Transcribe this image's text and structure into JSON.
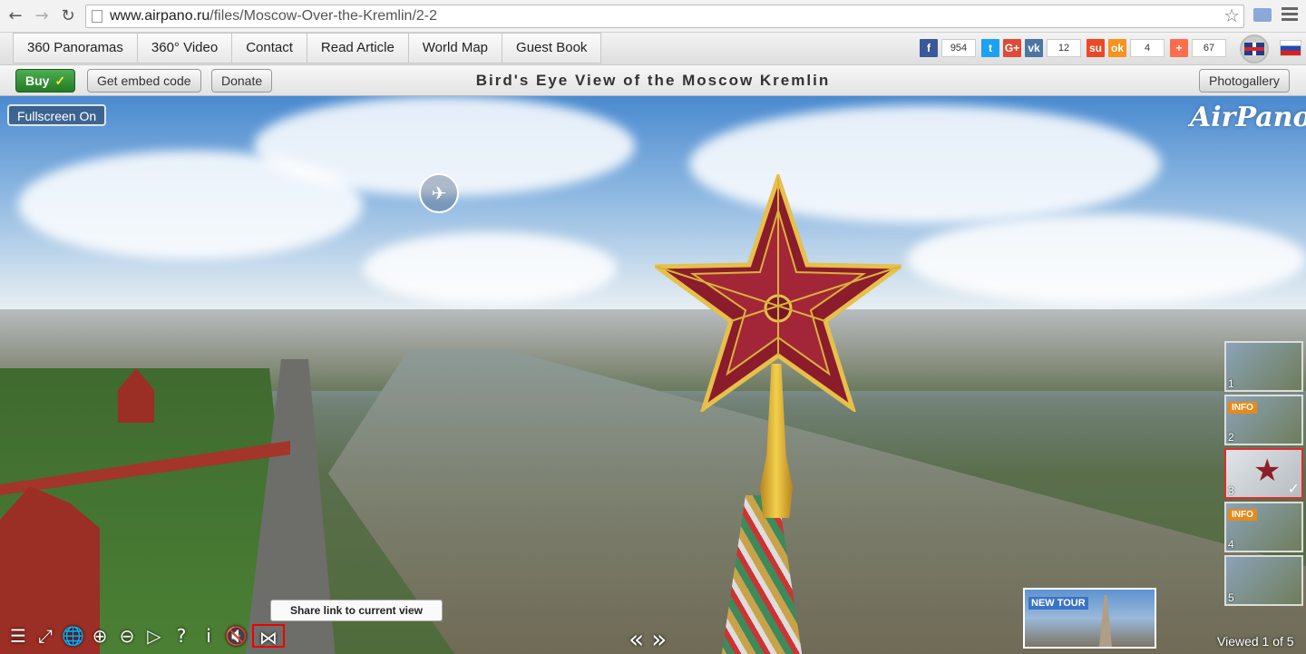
{
  "browser": {
    "url_host": "www.airpano.ru",
    "url_path": "/files/Moscow-Over-the-Kremlin/2-2",
    "back_icon": "←",
    "forward_icon": "→",
    "reload_icon": "↻",
    "star_icon": "☆"
  },
  "nav": {
    "tabs": [
      "360 Panoramas",
      "360° Video",
      "Contact",
      "Read Article",
      "World Map",
      "Guest Book"
    ]
  },
  "social": [
    {
      "id": "facebook",
      "glyph": "f",
      "color": "#3b5998",
      "count": "954"
    },
    {
      "id": "twitter",
      "glyph": "t",
      "color": "#1da1f2",
      "count": ""
    },
    {
      "id": "googleplus",
      "glyph": "G+",
      "color": "#dd4b39",
      "count": ""
    },
    {
      "id": "vk",
      "glyph": "vk",
      "color": "#4c75a3",
      "count": "12"
    },
    {
      "id": "stumbleupon",
      "glyph": "su",
      "color": "#eb4924",
      "count": ""
    },
    {
      "id": "odnoklassniki",
      "glyph": "ok",
      "color": "#f7931e",
      "count": "4"
    },
    {
      "id": "addthis",
      "glyph": "+",
      "color": "#fe6d4c",
      "count": "67"
    }
  ],
  "toolbar": {
    "buy_label": "Buy",
    "buy_check": "✓",
    "embed_label": "Get embed code",
    "donate_label": "Donate",
    "title": "Bird's Eye View of the Moscow Kremlin",
    "photogallery_label": "Photogallery"
  },
  "pano": {
    "fullscreen_label": "Fullscreen On",
    "logo": "AirPano",
    "heli_icon": "✈",
    "tooltip": "Share link to current view",
    "new_tour_label": "NEW TOUR",
    "viewed_text": "Viewed 1 of 5",
    "prev_icon": "«",
    "next_icon": "»",
    "thumbs": [
      {
        "num": "1",
        "info": "",
        "active": false
      },
      {
        "num": "2",
        "info": "INFO",
        "active": false
      },
      {
        "num": "3",
        "info": "",
        "active": true
      },
      {
        "num": "4",
        "info": "INFO",
        "active": false
      },
      {
        "num": "5",
        "info": "",
        "active": false
      }
    ],
    "controls": [
      {
        "name": "menu-toggle-icon",
        "glyph": "☰"
      },
      {
        "name": "fullscreen-icon",
        "glyph": "⤢"
      },
      {
        "name": "globe-icon",
        "glyph": "🌐"
      },
      {
        "name": "zoom-in-icon",
        "glyph": "⊕"
      },
      {
        "name": "zoom-out-icon",
        "glyph": "⊖"
      },
      {
        "name": "autoplay-icon",
        "glyph": "▷"
      },
      {
        "name": "help-icon",
        "glyph": "?"
      },
      {
        "name": "info-icon",
        "glyph": "i"
      },
      {
        "name": "mute-icon",
        "glyph": "🔇"
      }
    ],
    "share_glyph": "⋈"
  }
}
